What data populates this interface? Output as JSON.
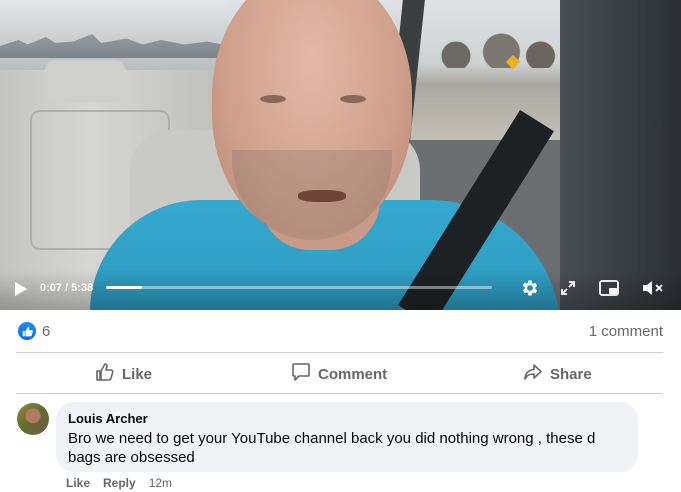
{
  "video": {
    "current_time": "0:07",
    "duration": "5:38",
    "time_display": "0:07 / 5:38",
    "progress": 0.021
  },
  "reactions": {
    "count": "6",
    "comments_label": "1 comment"
  },
  "actions": {
    "like_label": "Like",
    "comment_label": "Comment",
    "share_label": "Share"
  },
  "comment": {
    "author": "Louis Archer",
    "text": "Bro we need to get your YouTube channel back you did nothing wrong , these d bags are obsessed",
    "like_label": "Like",
    "reply_label": "Reply",
    "time": "12m"
  },
  "colors": {
    "facebook_blue": "#0866ff",
    "muted_text": "#65676b",
    "bubble_bg": "#f0f2f5"
  }
}
